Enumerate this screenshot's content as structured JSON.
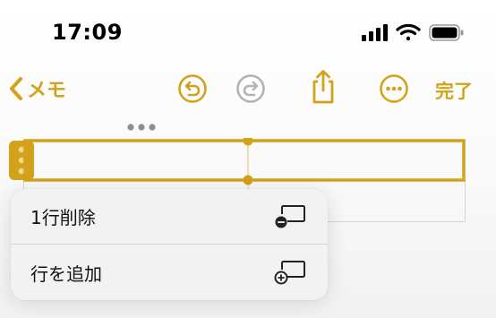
{
  "status_bar": {
    "time": "17:09",
    "icons": [
      "cellular-signal-icon",
      "wifi-icon",
      "battery-icon"
    ]
  },
  "nav": {
    "back_label": "メモ",
    "done_label": "完了",
    "accent_color": "#d1a21a",
    "icons": [
      "chevron-left-icon",
      "undo-icon",
      "redo-icon",
      "share-icon",
      "more-circle-icon"
    ]
  },
  "table": {
    "columns": 2,
    "selected_row": 1,
    "border_color": "#d1a21a"
  },
  "context_menu": {
    "items": [
      {
        "label": "1行削除",
        "icon": "delete-row-icon"
      },
      {
        "label": "行を追加",
        "icon": "add-row-icon"
      }
    ]
  }
}
